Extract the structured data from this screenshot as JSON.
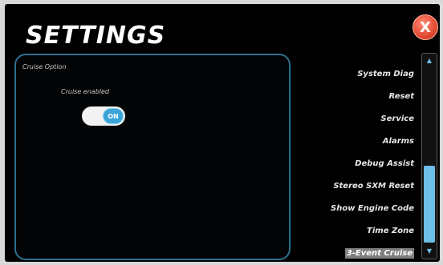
{
  "header": {
    "title": "SETTINGS",
    "close_label": "X"
  },
  "cruise_panel": {
    "label": "Cruise Option",
    "toggle_label": "Cruise enabled",
    "toggle_state": "ON"
  },
  "menu": {
    "items": [
      {
        "label": "System Diag"
      },
      {
        "label": "Reset"
      },
      {
        "label": "Service"
      },
      {
        "label": "Alarms"
      },
      {
        "label": "Debug Assist"
      },
      {
        "label": "Stereo SXM Reset"
      },
      {
        "label": "Show Engine Code"
      },
      {
        "label": "Time Zone"
      },
      {
        "label": "3-Event Cruise"
      }
    ],
    "selected_index": 8
  },
  "scrollbar": {
    "up_icon": "up-arrow-icon",
    "down_icon": "down-arrow-icon"
  },
  "colors": {
    "background": "#000000",
    "accent": "#3aa3d8",
    "panel_border": "#2f6f8f",
    "close_button": "#e34b33"
  }
}
